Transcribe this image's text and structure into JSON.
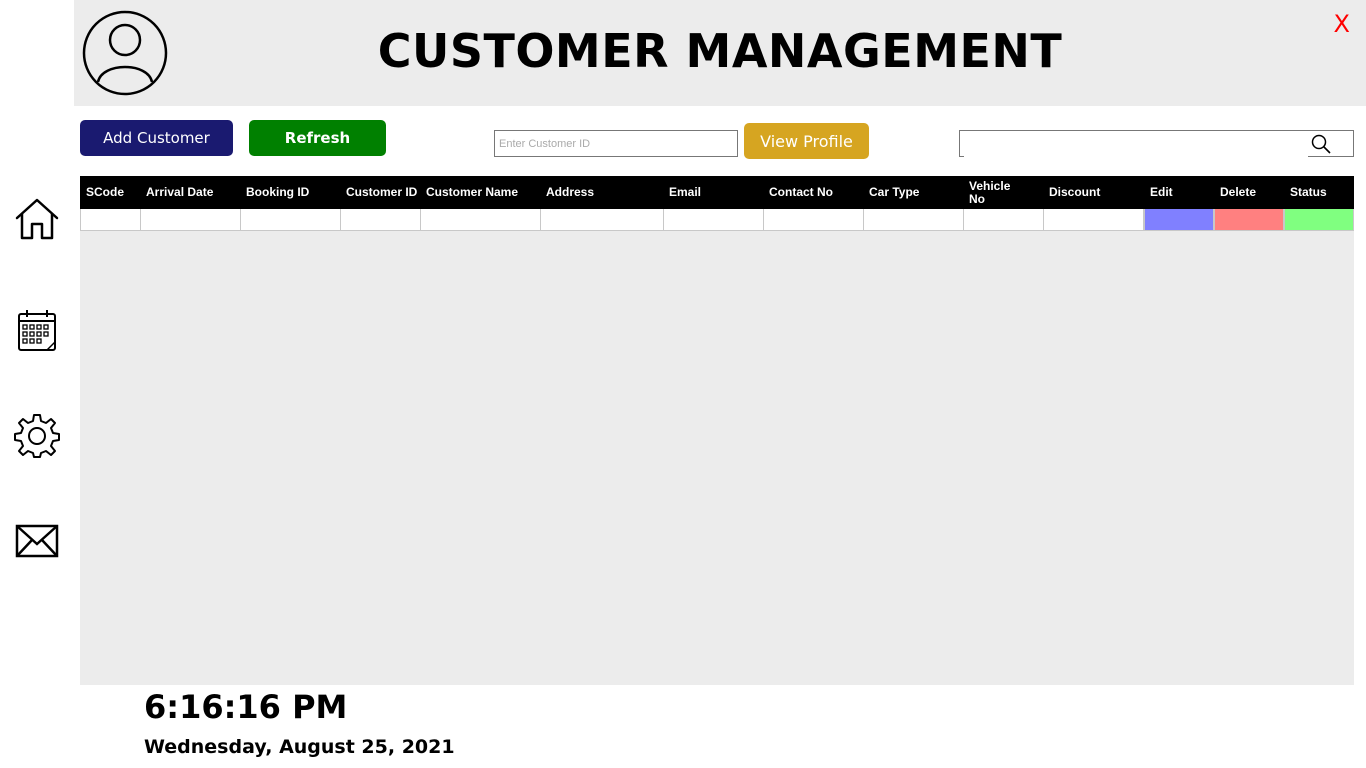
{
  "header": {
    "title": "CUSTOMER MANAGEMENT",
    "close_label": "X"
  },
  "sidebar": {
    "items": [
      {
        "icon": "home-icon"
      },
      {
        "icon": "calendar-icon"
      },
      {
        "icon": "gear-icon"
      },
      {
        "icon": "mail-icon"
      }
    ]
  },
  "toolbar": {
    "add_label": "Add Customer",
    "refresh_label": "Refresh",
    "customer_id_placeholder": "Enter Customer ID",
    "customer_id_value": "",
    "view_profile_label": "View Profile",
    "search_value": ""
  },
  "table": {
    "columns": [
      "SCode",
      "Arrival Date",
      "Booking ID",
      "Customer ID",
      "Customer Name",
      "Address",
      "Email",
      "Contact No",
      "Car Type",
      "Vehicle No",
      "Discount",
      "Edit",
      "Delete",
      "Status"
    ],
    "rows": [
      [
        "",
        "",
        "",
        "",
        "",
        "",
        "",
        "",
        "",
        "",
        "",
        "",
        "",
        ""
      ]
    ],
    "colors": {
      "edit": "#8080ff",
      "delete": "#ff8080",
      "status": "#80ff80"
    }
  },
  "footer": {
    "time": "6:16:16 PM",
    "date": "Wednesday, August 25, 2021"
  },
  "colors": {
    "add_button": "#1a1a70",
    "refresh_button": "#008000",
    "view_button": "#d6a521",
    "close": "#ff0000",
    "panel_bg": "#ececec"
  }
}
